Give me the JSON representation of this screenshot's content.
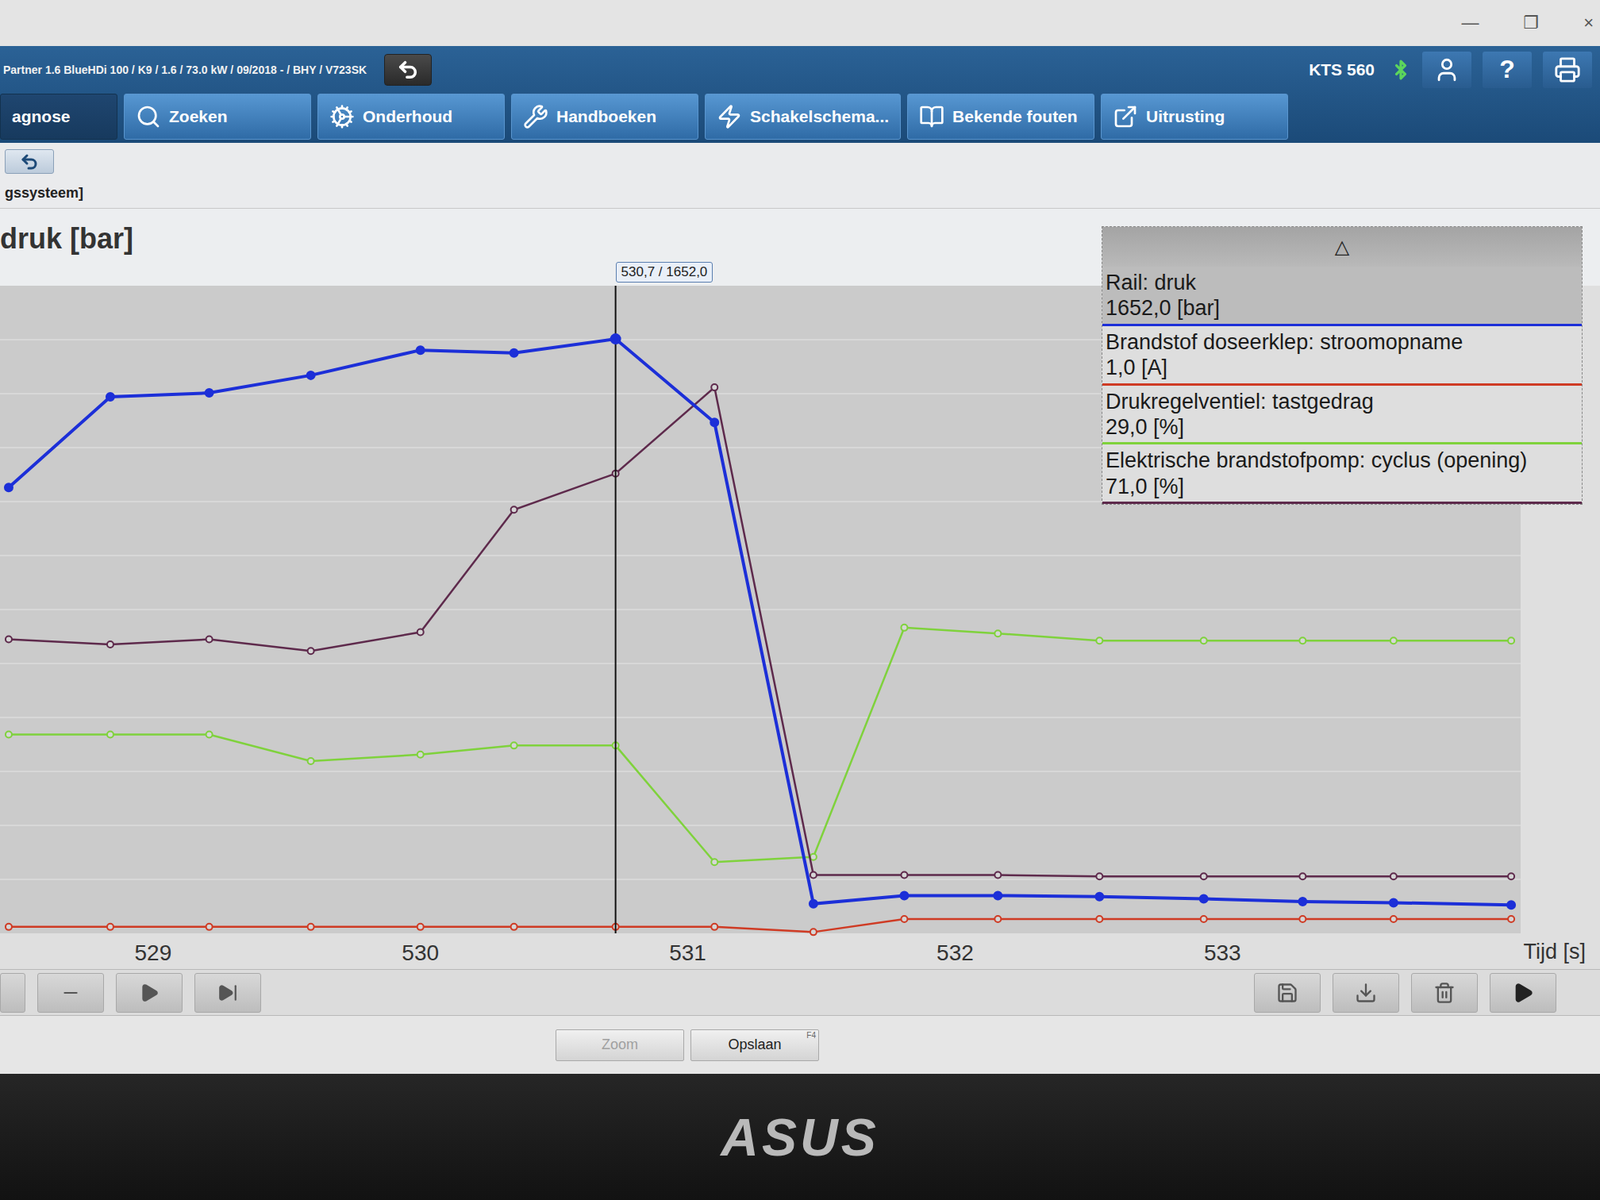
{
  "window": {
    "controls": [
      "—",
      "❐",
      "×"
    ]
  },
  "header": {
    "vehicle": "Partner 1.6 BlueHDi 100 / K9 / 1.6 / 73.0 kW / 09/2018 - / BHY / V723SK",
    "device": "KTS 560",
    "help": "?"
  },
  "tabs": [
    {
      "label": "agnose",
      "kind": "diagnose",
      "selected": true
    },
    {
      "label": "Zoeken",
      "kind": "search",
      "selected": false
    },
    {
      "label": "Onderhoud",
      "kind": "maintenance",
      "selected": false
    },
    {
      "label": "Handboeken",
      "kind": "manuals",
      "selected": false
    },
    {
      "label": "Schakelschema...",
      "kind": "wiring",
      "selected": false
    },
    {
      "label": "Bekende fouten",
      "kind": "known-faults",
      "selected": false
    },
    {
      "label": "Uitrusting",
      "kind": "equipment",
      "selected": false
    }
  ],
  "breadcrumb": "gssysteem]",
  "chart": {
    "title": "druk [bar]",
    "x_ticks": [
      "529",
      "530",
      "531",
      "532",
      "533"
    ],
    "x_axis_label": "Tijd [s]",
    "times": [
      528.46,
      528.84,
      529.21,
      529.59,
      530.0,
      530.35,
      530.73,
      531.1,
      531.47,
      531.81,
      532.16,
      532.54,
      532.93,
      533.3,
      533.64,
      534.08
    ],
    "cursor": {
      "time": 530.73,
      "label": "530,7 / 1652,0"
    },
    "series": [
      {
        "name": "Rail: druk",
        "value": "1652,0 [bar]",
        "color": "#1c2fd8",
        "scale_max": 1800,
        "selected": true,
        "values": [
          1239,
          1491,
          1502,
          1551,
          1621,
          1613,
          1652,
          1420,
          82,
          105,
          105,
          102,
          96,
          88,
          85,
          79
        ]
      },
      {
        "name": "Brandstof doseerklep: stroomopname",
        "value": "1,0 [A]",
        "color": "#cf3b24",
        "scale_max": 100,
        "selected": false,
        "values": [
          1.0,
          1.0,
          1.0,
          1.0,
          1.0,
          1.0,
          1.0,
          1.0,
          0.2,
          2.2,
          2.2,
          2.2,
          2.2,
          2.2,
          2.2,
          2.2
        ]
      },
      {
        "name": "Drukregelventiel: tastgedrag",
        "value": "29,0 [%]",
        "color": "#7fd23c",
        "scale_max": 100,
        "selected": false,
        "values": [
          30.7,
          30.7,
          30.7,
          26.6,
          27.6,
          29.0,
          29.0,
          11.0,
          11.8,
          47.2,
          46.3,
          45.2,
          45.2,
          45.2,
          45.2,
          45.2
        ]
      },
      {
        "name": "Elektrische brandstofpomp: cyclus (opening)",
        "value": "71,0 [%]",
        "color": "#5e2a4c",
        "scale_max": 100,
        "selected": false,
        "values": [
          45.4,
          44.6,
          45.4,
          43.6,
          46.5,
          65.4,
          71.0,
          84.3,
          9.0,
          9.0,
          9.0,
          8.8,
          8.8,
          8.8,
          8.8,
          8.8
        ]
      }
    ]
  },
  "legend": {
    "toggle": "△"
  },
  "controls": {
    "left": [
      {
        "kind": "previous"
      },
      {
        "kind": "zoom-out"
      },
      {
        "kind": "play"
      },
      {
        "kind": "step"
      }
    ],
    "right": [
      {
        "kind": "save"
      },
      {
        "kind": "import"
      },
      {
        "kind": "delete"
      },
      {
        "kind": "record"
      }
    ]
  },
  "footer": [
    {
      "label": "Zoom",
      "disabled": true
    },
    {
      "label": "Opslaan",
      "disabled": false,
      "hint": "F4"
    }
  ],
  "bezel": {
    "brand": "ASUS"
  }
}
